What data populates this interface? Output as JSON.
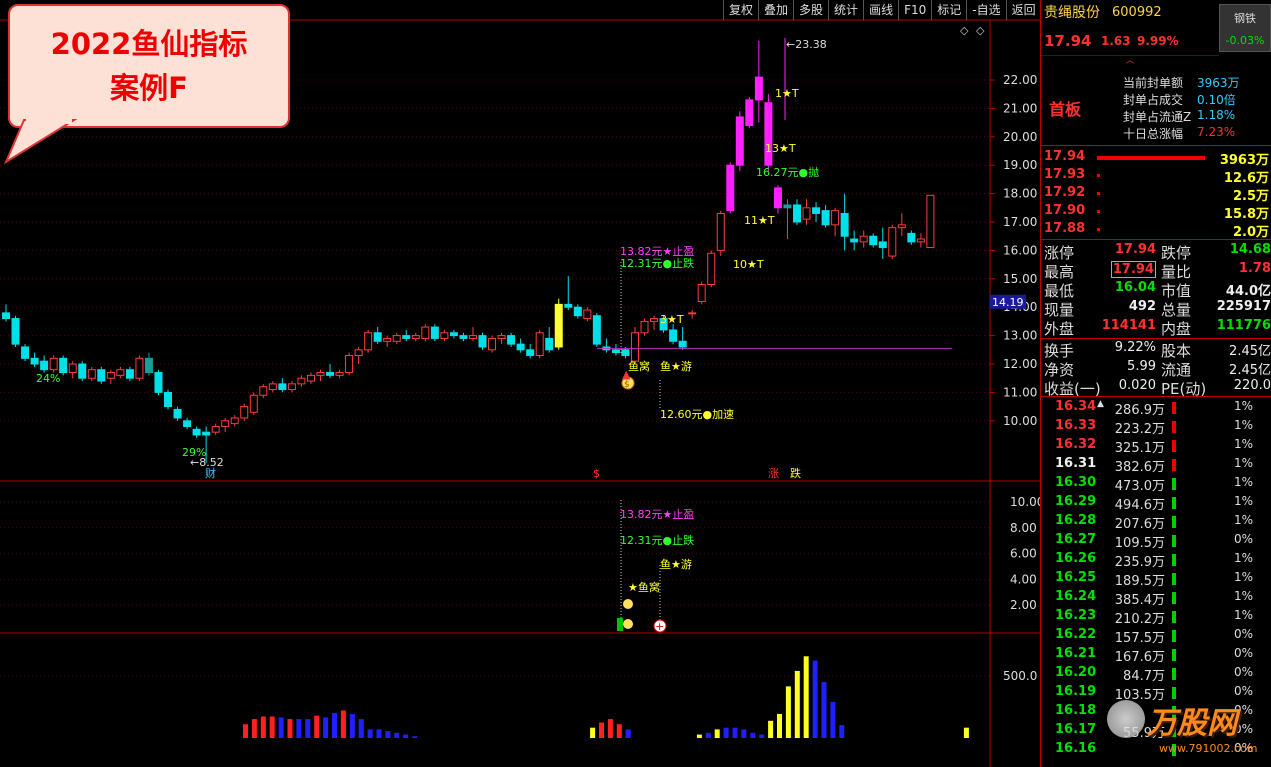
{
  "toolbar": {
    "items": [
      "复权",
      "叠加",
      "多股",
      "统计",
      "画线",
      "F10",
      "标记",
      "-自选",
      "返回"
    ]
  },
  "callout": {
    "line1": "2022鱼仙指标",
    "line2": "案例F"
  },
  "chart_data": {
    "type": "candlestick",
    "title": "",
    "y_ticks": [
      "22.00",
      "21.00",
      "20.00",
      "19.00",
      "18.00",
      "17.00",
      "16.00",
      "15.00",
      "14.00",
      "13.00",
      "12.00",
      "11.00",
      "10.00"
    ],
    "current_price_tag": "14.19",
    "candles": [
      {
        "o": 13.8,
        "h": 14.1,
        "l": 13.5,
        "c": 13.6
      },
      {
        "o": 13.6,
        "h": 13.7,
        "l": 12.6,
        "c": 12.7
      },
      {
        "o": 12.6,
        "h": 12.7,
        "l": 12.1,
        "c": 12.2
      },
      {
        "o": 12.2,
        "h": 12.4,
        "l": 11.9,
        "c": 12.0
      },
      {
        "o": 12.1,
        "h": 12.3,
        "l": 11.7,
        "c": 11.8
      },
      {
        "o": 11.8,
        "h": 12.3,
        "l": 11.7,
        "c": 12.2
      },
      {
        "o": 12.2,
        "h": 12.3,
        "l": 11.6,
        "c": 11.7
      },
      {
        "o": 11.7,
        "h": 12.1,
        "l": 11.5,
        "c": 12.0
      },
      {
        "o": 12.0,
        "h": 12.1,
        "l": 11.4,
        "c": 11.5
      },
      {
        "o": 11.5,
        "h": 11.9,
        "l": 11.4,
        "c": 11.8
      },
      {
        "o": 11.8,
        "h": 11.9,
        "l": 11.3,
        "c": 11.4
      },
      {
        "o": 11.5,
        "h": 11.8,
        "l": 11.3,
        "c": 11.7
      },
      {
        "o": 11.6,
        "h": 11.9,
        "l": 11.5,
        "c": 11.8
      },
      {
        "o": 11.8,
        "h": 11.9,
        "l": 11.4,
        "c": 11.5
      },
      {
        "o": 11.5,
        "h": 12.3,
        "l": 11.4,
        "c": 12.2
      },
      {
        "o": 12.2,
        "h": 12.4,
        "l": 11.6,
        "c": 11.7
      },
      {
        "o": 11.7,
        "h": 11.8,
        "l": 10.9,
        "c": 11.0
      },
      {
        "o": 11.0,
        "h": 11.1,
        "l": 10.4,
        "c": 10.5
      },
      {
        "o": 10.4,
        "h": 10.5,
        "l": 10.0,
        "c": 10.1
      },
      {
        "o": 10.0,
        "h": 10.1,
        "l": 9.7,
        "c": 9.8
      },
      {
        "o": 9.7,
        "h": 9.8,
        "l": 9.4,
        "c": 9.5
      },
      {
        "o": 9.6,
        "h": 9.8,
        "l": 8.52,
        "c": 9.5
      },
      {
        "o": 9.6,
        "h": 9.9,
        "l": 9.5,
        "c": 9.8
      },
      {
        "o": 9.8,
        "h": 10.1,
        "l": 9.6,
        "c": 10.0
      },
      {
        "o": 9.9,
        "h": 10.2,
        "l": 9.8,
        "c": 10.1
      },
      {
        "o": 10.1,
        "h": 10.6,
        "l": 10.0,
        "c": 10.5
      },
      {
        "o": 10.3,
        "h": 11.0,
        "l": 10.2,
        "c": 10.9
      },
      {
        "o": 10.9,
        "h": 11.3,
        "l": 10.8,
        "c": 11.2
      },
      {
        "o": 11.1,
        "h": 11.4,
        "l": 11.0,
        "c": 11.3
      },
      {
        "o": 11.3,
        "h": 11.5,
        "l": 11.0,
        "c": 11.1
      },
      {
        "o": 11.1,
        "h": 11.4,
        "l": 11.0,
        "c": 11.3
      },
      {
        "o": 11.3,
        "h": 11.6,
        "l": 11.2,
        "c": 11.5
      },
      {
        "o": 11.4,
        "h": 11.7,
        "l": 11.3,
        "c": 11.6
      },
      {
        "o": 11.6,
        "h": 11.8,
        "l": 11.4,
        "c": 11.7
      },
      {
        "o": 11.7,
        "h": 12.0,
        "l": 11.5,
        "c": 11.6
      },
      {
        "o": 11.6,
        "h": 11.8,
        "l": 11.5,
        "c": 11.7
      },
      {
        "o": 11.7,
        "h": 12.4,
        "l": 11.6,
        "c": 12.3
      },
      {
        "o": 12.3,
        "h": 12.6,
        "l": 12.0,
        "c": 12.5
      },
      {
        "o": 12.5,
        "h": 13.2,
        "l": 12.4,
        "c": 13.1
      },
      {
        "o": 13.1,
        "h": 13.3,
        "l": 12.7,
        "c": 12.8
      },
      {
        "o": 12.8,
        "h": 13.0,
        "l": 12.6,
        "c": 12.9
      },
      {
        "o": 12.8,
        "h": 13.1,
        "l": 12.7,
        "c": 13.0
      },
      {
        "o": 13.0,
        "h": 13.2,
        "l": 12.8,
        "c": 12.9
      },
      {
        "o": 12.9,
        "h": 13.1,
        "l": 12.8,
        "c": 13.0
      },
      {
        "o": 12.9,
        "h": 13.4,
        "l": 12.8,
        "c": 13.3
      },
      {
        "o": 13.3,
        "h": 13.4,
        "l": 12.8,
        "c": 12.9
      },
      {
        "o": 12.9,
        "h": 13.2,
        "l": 12.8,
        "c": 13.1
      },
      {
        "o": 13.1,
        "h": 13.2,
        "l": 12.9,
        "c": 13.0
      },
      {
        "o": 13.0,
        "h": 13.1,
        "l": 12.8,
        "c": 12.9
      },
      {
        "o": 12.9,
        "h": 13.3,
        "l": 12.8,
        "c": 13.0
      },
      {
        "o": 13.0,
        "h": 13.1,
        "l": 12.5,
        "c": 12.6
      },
      {
        "o": 12.5,
        "h": 13.0,
        "l": 12.4,
        "c": 12.9
      },
      {
        "o": 12.9,
        "h": 13.1,
        "l": 12.7,
        "c": 13.0
      },
      {
        "o": 13.0,
        "h": 13.1,
        "l": 12.6,
        "c": 12.7
      },
      {
        "o": 12.7,
        "h": 12.9,
        "l": 12.4,
        "c": 12.5
      },
      {
        "o": 12.5,
        "h": 12.7,
        "l": 12.2,
        "c": 12.3
      },
      {
        "o": 12.3,
        "h": 13.2,
        "l": 12.2,
        "c": 13.1
      },
      {
        "o": 12.9,
        "h": 13.3,
        "l": 12.4,
        "c": 12.5
      },
      {
        "o": 12.6,
        "h": 14.3,
        "l": 12.5,
        "c": 14.1
      },
      {
        "o": 14.1,
        "h": 15.1,
        "l": 13.9,
        "c": 14.0
      },
      {
        "o": 14.0,
        "h": 14.1,
        "l": 13.6,
        "c": 13.7
      },
      {
        "o": 13.6,
        "h": 14.0,
        "l": 13.5,
        "c": 13.9
      },
      {
        "o": 13.7,
        "h": 13.8,
        "l": 12.6,
        "c": 12.7
      },
      {
        "o": 12.6,
        "h": 12.9,
        "l": 12.4,
        "c": 12.5
      },
      {
        "o": 12.5,
        "h": 12.7,
        "l": 12.3,
        "c": 12.4
      },
      {
        "o": 12.5,
        "h": 12.6,
        "l": 12.2,
        "c": 12.3
      },
      {
        "o": 12.1,
        "h": 13.3,
        "l": 12.0,
        "c": 13.1
      },
      {
        "o": 13.1,
        "h": 13.6,
        "l": 13.0,
        "c": 13.5
      },
      {
        "o": 13.5,
        "h": 13.7,
        "l": 13.2,
        "c": 13.6
      },
      {
        "o": 13.6,
        "h": 13.7,
        "l": 13.1,
        "c": 13.2
      },
      {
        "o": 13.2,
        "h": 13.4,
        "l": 12.7,
        "c": 12.8
      },
      {
        "o": 12.8,
        "h": 13.3,
        "l": 12.5,
        "c": 12.6
      },
      {
        "o": 13.8,
        "h": 13.9,
        "l": 13.6,
        "c": 13.8
      },
      {
        "o": 14.2,
        "h": 14.9,
        "l": 14.1,
        "c": 14.8
      },
      {
        "o": 14.8,
        "h": 16.0,
        "l": 14.7,
        "c": 15.9
      },
      {
        "o": 16.0,
        "h": 17.4,
        "l": 15.8,
        "c": 17.3
      },
      {
        "o": 17.4,
        "h": 19.1,
        "l": 17.3,
        "c": 19.0
      },
      {
        "o": 19.0,
        "h": 20.9,
        "l": 18.8,
        "c": 20.7
      },
      {
        "o": 20.4,
        "h": 21.4,
        "l": 20.3,
        "c": 21.3
      },
      {
        "o": 21.3,
        "h": 23.38,
        "l": 20.5,
        "c": 22.1
      },
      {
        "o": 21.2,
        "h": 21.5,
        "l": 18.8,
        "c": 19.0
      },
      {
        "o": 18.2,
        "h": 18.3,
        "l": 17.3,
        "c": 17.5
      },
      {
        "o": 17.5,
        "h": 17.8,
        "l": 16.4,
        "c": 17.6
      },
      {
        "o": 17.6,
        "h": 17.8,
        "l": 16.9,
        "c": 17.0
      },
      {
        "o": 17.1,
        "h": 17.8,
        "l": 16.9,
        "c": 17.5
      },
      {
        "o": 17.5,
        "h": 17.7,
        "l": 17.0,
        "c": 17.3
      },
      {
        "o": 17.4,
        "h": 17.6,
        "l": 16.8,
        "c": 16.9
      },
      {
        "o": 16.9,
        "h": 17.5,
        "l": 16.5,
        "c": 17.4
      },
      {
        "o": 17.3,
        "h": 18.0,
        "l": 16.0,
        "c": 16.5
      },
      {
        "o": 16.4,
        "h": 16.7,
        "l": 16.0,
        "c": 16.3
      },
      {
        "o": 16.3,
        "h": 16.7,
        "l": 16.1,
        "c": 16.5
      },
      {
        "o": 16.5,
        "h": 16.6,
        "l": 16.1,
        "c": 16.2
      },
      {
        "o": 16.3,
        "h": 16.8,
        "l": 15.7,
        "c": 16.1
      },
      {
        "o": 15.8,
        "h": 16.9,
        "l": 15.7,
        "c": 16.8
      },
      {
        "o": 16.8,
        "h": 17.3,
        "l": 16.5,
        "c": 16.9
      },
      {
        "o": 16.6,
        "h": 16.7,
        "l": 16.2,
        "c": 16.3
      },
      {
        "o": 16.3,
        "h": 16.6,
        "l": 16.1,
        "c": 16.4
      },
      {
        "o": 16.1,
        "h": 17.94,
        "l": 16.1,
        "c": 17.94
      }
    ],
    "high_label": "23.38",
    "low_label": "8.52",
    "annotations": [
      "24%",
      "29%",
      "13.82元★止盈",
      "12.31元●止跌",
      "鱼窝",
      "鱼★游",
      "12.60元●加速",
      "3★T",
      "10★T",
      "11★T",
      "13★T",
      "16.27元●抛",
      "1★T"
    ],
    "bottom_markers": [
      "财",
      "$",
      "涨",
      "跌"
    ],
    "sub1_ticks": [
      "10.00",
      "8.00",
      "6.00",
      "4.00",
      "2.00"
    ],
    "sub1_annotations": [
      "13.82元★止盈",
      "12.31元●止跌",
      "鱼★游",
      "★鱼窝"
    ],
    "sub2_tick": "500.0",
    "volume_bars": [
      {
        "v": 0.16,
        "c": "red"
      },
      {
        "v": 0.22,
        "c": "red"
      },
      {
        "v": 0.25,
        "c": "red"
      },
      {
        "v": 0.25,
        "c": "red"
      },
      {
        "v": 0.24,
        "c": "blue"
      },
      {
        "v": 0.22,
        "c": "red"
      },
      {
        "v": 0.22,
        "c": "blue"
      },
      {
        "v": 0.22,
        "c": "blue"
      },
      {
        "v": 0.26,
        "c": "red"
      },
      {
        "v": 0.24,
        "c": "blue"
      },
      {
        "v": 0.29,
        "c": "blue"
      },
      {
        "v": 0.32,
        "c": "red"
      },
      {
        "v": 0.28,
        "c": "blue"
      },
      {
        "v": 0.22,
        "c": "blue"
      },
      {
        "v": 0.1,
        "c": "blue"
      },
      {
        "v": 0.1,
        "c": "blue"
      },
      {
        "v": 0.08,
        "c": "blue"
      },
      {
        "v": 0.06,
        "c": "blue"
      },
      {
        "v": 0.04,
        "c": "blue"
      },
      {
        "v": 0.02,
        "c": "blue"
      },
      {
        "v": 0,
        "c": "blue"
      },
      {
        "v": 0,
        "c": "blue"
      },
      {
        "v": 0,
        "c": "blue"
      },
      {
        "v": 0,
        "c": "blue"
      },
      {
        "v": 0,
        "c": "blue"
      },
      {
        "v": 0,
        "c": "blue"
      },
      {
        "v": 0,
        "c": "blue"
      },
      {
        "v": 0,
        "c": "blue"
      },
      {
        "v": 0,
        "c": "blue"
      },
      {
        "v": 0,
        "c": "blue"
      },
      {
        "v": 0,
        "c": "blue"
      },
      {
        "v": 0,
        "c": "blue"
      },
      {
        "v": 0,
        "c": "blue"
      },
      {
        "v": 0,
        "c": "blue"
      },
      {
        "v": 0,
        "c": "blue"
      },
      {
        "v": 0,
        "c": "blue"
      },
      {
        "v": 0,
        "c": "blue"
      },
      {
        "v": 0,
        "c": "blue"
      },
      {
        "v": 0,
        "c": "blue"
      },
      {
        "v": 0.12,
        "c": "yellow"
      },
      {
        "v": 0.18,
        "c": "red"
      },
      {
        "v": 0.22,
        "c": "red"
      },
      {
        "v": 0.16,
        "c": "red"
      },
      {
        "v": 0.1,
        "c": "blue"
      },
      {
        "v": 0,
        "c": "blue"
      },
      {
        "v": 0,
        "c": "blue"
      },
      {
        "v": 0,
        "c": "blue"
      },
      {
        "v": 0,
        "c": "blue"
      },
      {
        "v": 0,
        "c": "blue"
      },
      {
        "v": 0,
        "c": "blue"
      },
      {
        "v": 0,
        "c": "blue"
      },
      {
        "v": 0.04,
        "c": "yellow"
      },
      {
        "v": 0.06,
        "c": "blue"
      },
      {
        "v": 0.1,
        "c": "yellow"
      },
      {
        "v": 0.12,
        "c": "blue"
      },
      {
        "v": 0.12,
        "c": "blue"
      },
      {
        "v": 0.1,
        "c": "blue"
      },
      {
        "v": 0.06,
        "c": "blue"
      },
      {
        "v": 0.04,
        "c": "blue"
      },
      {
        "v": 0.2,
        "c": "yellow"
      },
      {
        "v": 0.28,
        "c": "yellow"
      },
      {
        "v": 0.6,
        "c": "yellow"
      },
      {
        "v": 0.78,
        "c": "yellow"
      },
      {
        "v": 0.95,
        "c": "yellow"
      },
      {
        "v": 0.9,
        "c": "blue"
      },
      {
        "v": 0.65,
        "c": "blue"
      },
      {
        "v": 0.42,
        "c": "blue"
      },
      {
        "v": 0.15,
        "c": "blue"
      },
      {
        "v": 0,
        "c": "blue"
      },
      {
        "v": 0,
        "c": "blue"
      },
      {
        "v": 0,
        "c": "blue"
      },
      {
        "v": 0,
        "c": "blue"
      },
      {
        "v": 0,
        "c": "blue"
      },
      {
        "v": 0,
        "c": "blue"
      },
      {
        "v": 0,
        "c": "blue"
      },
      {
        "v": 0,
        "c": "blue"
      },
      {
        "v": 0,
        "c": "blue"
      },
      {
        "v": 0,
        "c": "blue"
      },
      {
        "v": 0,
        "c": "blue"
      },
      {
        "v": 0,
        "c": "blue"
      },
      {
        "v": 0,
        "c": "blue"
      },
      {
        "v": 0.12,
        "c": "yellow"
      }
    ]
  },
  "side": {
    "stock_name": "贵绳股份",
    "stock_code": "600992",
    "sector": "钢铁",
    "sector_chg": "-0.03%",
    "price": "17.94",
    "change": "1.63",
    "change_pct": "9.99%",
    "limit_label": "首板",
    "seal_info": [
      {
        "k": "当前封单额",
        "v": "3963万"
      },
      {
        "k": "封单占成交",
        "v": "0.10倍"
      },
      {
        "k": "封单占流通Z",
        "v": "1.18%"
      },
      {
        "k": "十日总涨幅",
        "v": "7.23%"
      }
    ],
    "bids": [
      {
        "p": "17.94",
        "v": "3963万"
      },
      {
        "p": "17.93",
        "v": "12.6万"
      },
      {
        "p": "17.92",
        "v": "2.5万"
      },
      {
        "p": "17.90",
        "v": "15.8万"
      },
      {
        "p": "17.88",
        "v": "2.0万"
      }
    ],
    "stats": [
      {
        "k1": "涨停",
        "v1": "17.94",
        "k2": "跌停",
        "v2": "14.68"
      },
      {
        "k1": "最高",
        "v1": "17.94",
        "k2": "量比",
        "v2": "1.78"
      },
      {
        "k1": "最低",
        "v1": "16.04",
        "k2": "市值",
        "v2": "44.0亿"
      },
      {
        "k1": "现量",
        "v1": "492",
        "k2": "总量",
        "v2": "225917"
      },
      {
        "k1": "外盘",
        "v1": "114141",
        "k2": "内盘",
        "v2": "111776"
      }
    ],
    "stats2": [
      {
        "k1": "换手",
        "v1": "9.22%",
        "k2": "股本",
        "v2": "2.45亿"
      },
      {
        "k1": "净资",
        "v1": "5.99",
        "k2": "流通",
        "v2": "2.45亿"
      },
      {
        "k1": "收益(一)",
        "v1": "0.020",
        "k2": "PE(动)",
        "v2": "220.0"
      }
    ],
    "distribution": [
      {
        "p": "16.34",
        "v": "286.9万",
        "pct": "1%",
        "c": "red"
      },
      {
        "p": "16.33",
        "v": "223.2万",
        "pct": "1%",
        "c": "red"
      },
      {
        "p": "16.32",
        "v": "325.1万",
        "pct": "1%",
        "c": "red"
      },
      {
        "p": "16.31",
        "v": "382.6万",
        "pct": "1%",
        "c": "white"
      },
      {
        "p": "16.30",
        "v": "473.0万",
        "pct": "1%",
        "c": "green"
      },
      {
        "p": "16.29",
        "v": "494.6万",
        "pct": "1%",
        "c": "green"
      },
      {
        "p": "16.28",
        "v": "207.6万",
        "pct": "1%",
        "c": "green"
      },
      {
        "p": "16.27",
        "v": "109.5万",
        "pct": "0%",
        "c": "green"
      },
      {
        "p": "16.26",
        "v": "235.9万",
        "pct": "1%",
        "c": "green"
      },
      {
        "p": "16.25",
        "v": "189.5万",
        "pct": "1%",
        "c": "green"
      },
      {
        "p": "16.24",
        "v": "385.4万",
        "pct": "1%",
        "c": "green"
      },
      {
        "p": "16.23",
        "v": "210.2万",
        "pct": "1%",
        "c": "green"
      },
      {
        "p": "16.22",
        "v": "157.5万",
        "pct": "0%",
        "c": "green"
      },
      {
        "p": "16.21",
        "v": "167.6万",
        "pct": "0%",
        "c": "green"
      },
      {
        "p": "16.20",
        "v": "84.7万",
        "pct": "0%",
        "c": "green"
      },
      {
        "p": "16.19",
        "v": "103.5万",
        "pct": "0%",
        "c": "green"
      },
      {
        "p": "16.18",
        "v": "",
        "pct": "0%",
        "c": "green"
      },
      {
        "p": "16.17",
        "v": "55.9万",
        "pct": "0%",
        "c": "green"
      },
      {
        "p": "16.16",
        "v": "",
        "pct": "0%",
        "c": "green"
      }
    ],
    "watermark": "万股网",
    "watermark_url": "www.791002.com"
  }
}
